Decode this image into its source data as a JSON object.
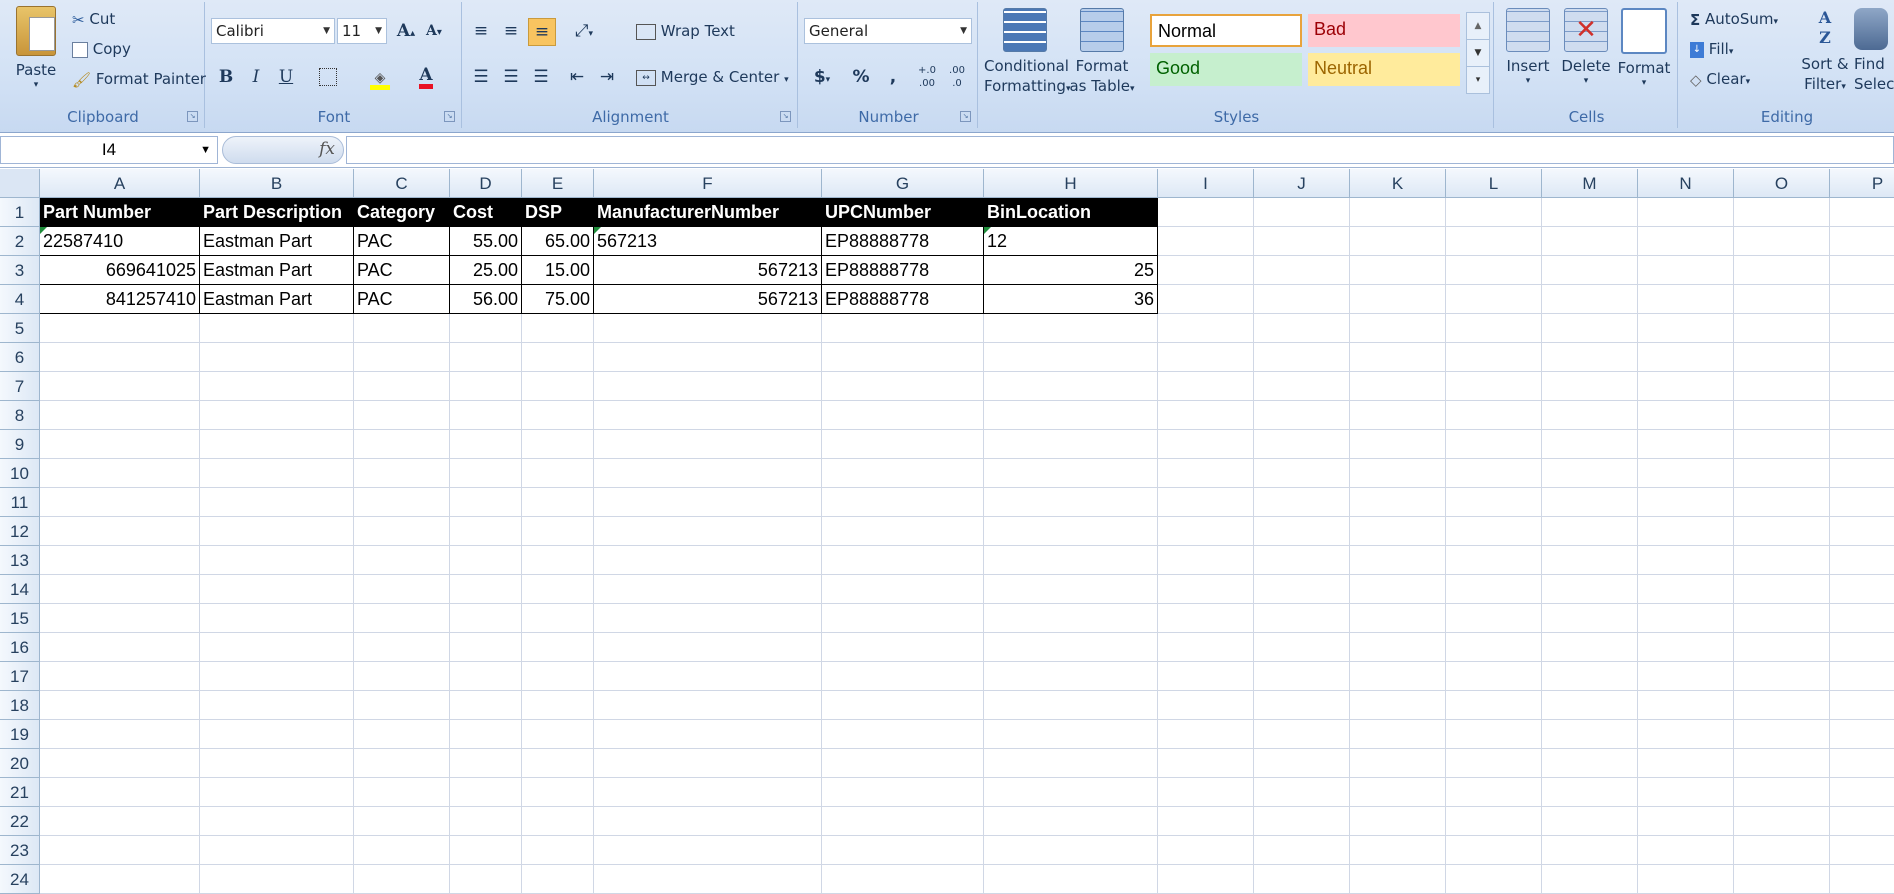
{
  "ribbon": {
    "clipboard": {
      "label": "Clipboard",
      "paste": "Paste",
      "cut": "Cut",
      "copy": "Copy",
      "format_painter": "Format Painter"
    },
    "font": {
      "label": "Font",
      "family": "Calibri",
      "size": "11",
      "bold": "B",
      "italic": "I",
      "underline": "U",
      "font_color": "#e81123",
      "fill_color": "#ffff00"
    },
    "alignment": {
      "label": "Alignment",
      "wrap_text": "Wrap Text",
      "merge_center": "Merge & Center"
    },
    "number": {
      "label": "Number",
      "format": "General",
      "currency": "$",
      "percent": "%",
      "comma": ",",
      "inc_decimal": "+.0 .00",
      "dec_decimal": ".00 .0"
    },
    "styles": {
      "label": "Styles",
      "conditional_1": "Conditional",
      "conditional_2": "Formatting",
      "format_table_1": "Format",
      "format_table_2": "as Table",
      "normal": "Normal",
      "bad": "Bad",
      "good": "Good",
      "neutral": "Neutral"
    },
    "cells": {
      "label": "Cells",
      "insert": "Insert",
      "delete": "Delete",
      "format": "Format"
    },
    "editing": {
      "label": "Editing",
      "autosum": "AutoSum",
      "fill": "Fill",
      "clear": "Clear",
      "sort_1": "Sort &",
      "sort_2": "Filter",
      "find_1": "Find",
      "find_2": "Selec"
    }
  },
  "formula_bar": {
    "name_box": "I4",
    "fx": "fx",
    "formula": ""
  },
  "sheet": {
    "columns": [
      "A",
      "B",
      "C",
      "D",
      "E",
      "F",
      "G",
      "H",
      "I",
      "J",
      "K",
      "L",
      "M",
      "N",
      "O",
      "P"
    ],
    "rows": [
      "1",
      "2",
      "3",
      "4",
      "5",
      "6",
      "7",
      "8",
      "9",
      "10",
      "11",
      "12",
      "13",
      "14",
      "15",
      "16",
      "17",
      "18",
      "19",
      "20",
      "21",
      "22",
      "23",
      "24"
    ],
    "header_row": [
      "Part Number",
      "Part Description",
      "Category",
      "Cost",
      "DSP",
      "ManufacturerNumber",
      "UPCNumber",
      "BinLocation"
    ],
    "data_rows": [
      [
        "22587410",
        "Eastman Part",
        "PAC",
        "55.00",
        "65.00",
        "567213",
        "EP88888778",
        "12"
      ],
      [
        "669641025",
        "Eastman Part",
        "PAC",
        "25.00",
        "15.00",
        "567213",
        "EP88888778",
        "25"
      ],
      [
        "841257410",
        "Eastman Part",
        "PAC",
        "56.00",
        "75.00",
        "567213",
        "EP88888778",
        "36"
      ]
    ]
  }
}
